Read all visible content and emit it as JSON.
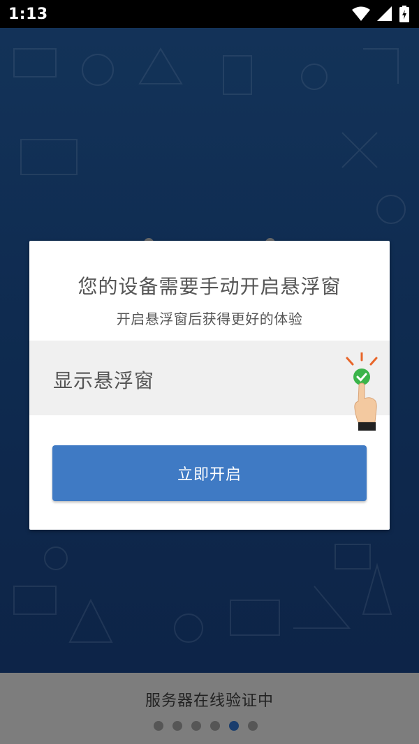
{
  "status_bar": {
    "time": "1:13",
    "icons": [
      "wifi-icon",
      "signal-icon",
      "battery-charging-icon"
    ]
  },
  "dialog": {
    "title": "您的设备需要手动开启悬浮窗",
    "subtitle": "开启悬浮窗后获得更好的体验",
    "option_label": "显示悬浮窗",
    "option_checked": true,
    "button_label": "立即开启"
  },
  "footer": {
    "status_text": "服务器在线验证中",
    "page_count": 6,
    "active_page_index": 4
  },
  "colors": {
    "background_blue": "#163a65",
    "button_blue": "#3f7ac4",
    "check_green": "#3bb44a",
    "tap_orange": "#e8662a",
    "footer_gray": "#7d7d7d"
  }
}
